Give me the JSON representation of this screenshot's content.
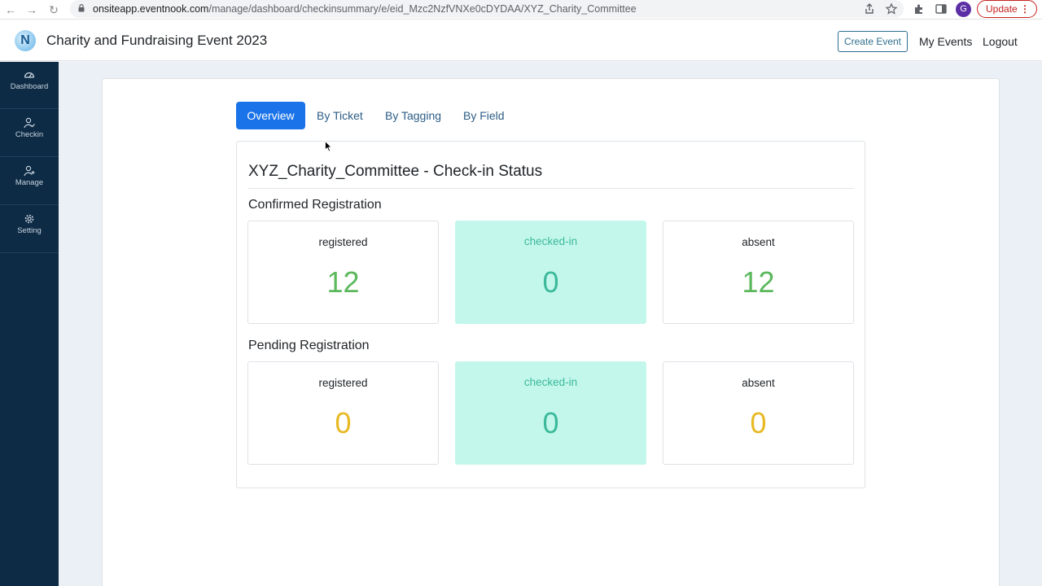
{
  "browser": {
    "url_domain": "onsiteapp.eventnook.com",
    "url_path": "/manage/dashboard/checkinsummary/e/eid_Mzc2NzfVNXe0cDYDAA/XYZ_Charity_Committee",
    "profile_initial": "G",
    "update_label": "Update"
  },
  "header": {
    "logo_letter": "N",
    "title": "Charity and Fundraising Event 2023",
    "create_event_label": "Create Event",
    "my_events_label": "My Events",
    "logout_label": "Logout"
  },
  "sidebar": {
    "items": [
      {
        "label": "Dashboard",
        "icon": "gauge-icon"
      },
      {
        "label": "Checkin",
        "icon": "user-check-icon"
      },
      {
        "label": "Manage",
        "icon": "user-plus-icon"
      },
      {
        "label": "Setting",
        "icon": "gear-icon"
      }
    ]
  },
  "tabs": [
    {
      "label": "Overview",
      "active": true
    },
    {
      "label": "By Ticket",
      "active": false
    },
    {
      "label": "By Tagging",
      "active": false
    },
    {
      "label": "By Field",
      "active": false
    }
  ],
  "panel": {
    "title": "XYZ_Charity_Committee - Check-in Status",
    "confirmed": {
      "title": "Confirmed Registration",
      "registered_label": "registered",
      "registered_value": "12",
      "checked_in_label": "checked-in",
      "checked_in_value": "0",
      "absent_label": "absent",
      "absent_value": "12"
    },
    "pending": {
      "title": "Pending Registration",
      "registered_label": "registered",
      "registered_value": "0",
      "checked_in_label": "checked-in",
      "checked_in_value": "0",
      "absent_label": "absent",
      "absent_value": "0"
    }
  },
  "colors": {
    "sidebar_bg": "#0d2b45",
    "active_tab": "#1a73e8",
    "highlight_box": "#c4f7ec",
    "value_green": "#5cb85c",
    "value_teal": "#3bb99a",
    "value_yellow": "#e8b923"
  }
}
